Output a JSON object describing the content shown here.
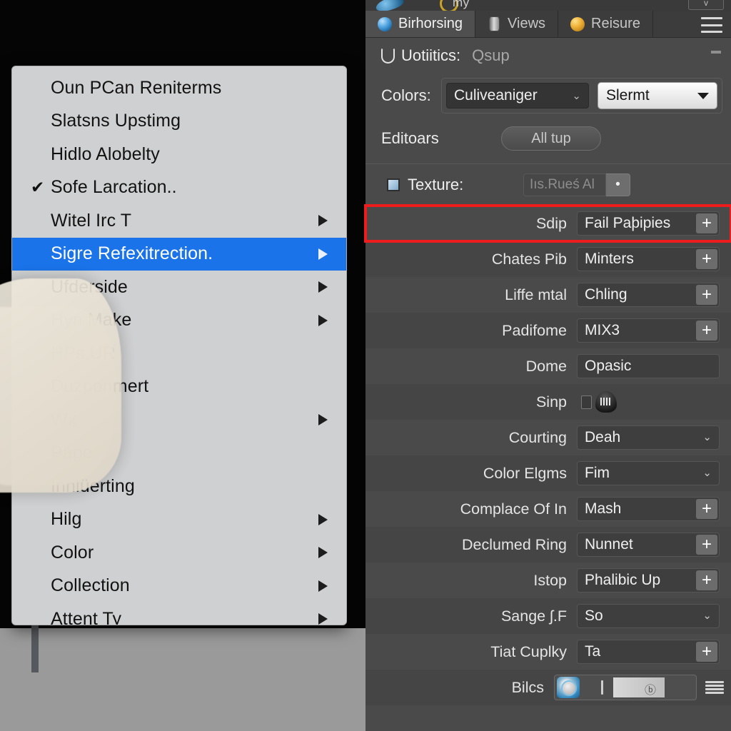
{
  "canvas": {
    "name": "viewport-left"
  },
  "context_menu": {
    "items": [
      {
        "label": "Oun PCan Reniterms",
        "checked": false,
        "submenu": false
      },
      {
        "label": "Slatsns Upstimg",
        "checked": false,
        "submenu": false
      },
      {
        "label": "Hidlo Alobelty",
        "checked": false,
        "submenu": false
      },
      {
        "label": "Sofe Larcation..",
        "checked": true,
        "submenu": false
      },
      {
        "label": "Witel Irc T",
        "checked": false,
        "submenu": true
      },
      {
        "label": "Sigre Refexitrection.",
        "checked": false,
        "submenu": true,
        "selected": true
      },
      {
        "label": "Ufderside",
        "checked": false,
        "submenu": true
      },
      {
        "label": "Hyn Make",
        "checked": false,
        "submenu": true
      },
      {
        "label": "HPs UR",
        "checked": false,
        "submenu": false
      },
      {
        "label": "Duzponmert",
        "checked": false,
        "submenu": false
      },
      {
        "label": "Wx",
        "checked": false,
        "submenu": true
      },
      {
        "label": "Pape",
        "checked": false,
        "submenu": false
      },
      {
        "label": "Inniüerting",
        "checked": false,
        "submenu": false
      },
      {
        "label": "Hilg",
        "checked": false,
        "submenu": true
      },
      {
        "label": "Color",
        "checked": false,
        "submenu": true
      },
      {
        "label": "Collection",
        "checked": false,
        "submenu": true
      },
      {
        "label": "Attent Ty",
        "checked": false,
        "submenu": true
      }
    ],
    "checkmark": "✔",
    "highlight_color": "#1a73e8"
  },
  "panel": {
    "topbar": {
      "title": "my",
      "corner_button": "v"
    },
    "tabs": [
      {
        "label": "Birhorsing",
        "icon": "blue-sphere-icon",
        "active": true
      },
      {
        "label": "Views",
        "icon": "cylinder-icon",
        "active": false
      },
      {
        "label": "Reisure",
        "icon": "orange-sphere-icon",
        "active": false
      }
    ],
    "menu_icon": "hamburger-icon",
    "header": {
      "label": "Uotiitics:",
      "value": "Qsup",
      "minimize": "minimize-icon"
    },
    "colors_row": {
      "label": "Colors:",
      "select_dark": {
        "value": "Culiveaniger",
        "chevron": "⌄"
      },
      "select_light": {
        "value": "Slermt"
      }
    },
    "editors_row": {
      "label": "Editoars",
      "button": "All tup"
    },
    "texture_row": {
      "label": "Texture:",
      "value": "Iıs.Rueś Al",
      "button": "•"
    },
    "properties": [
      {
        "label": "Sdip",
        "value": "Fail Paþipies",
        "control": "plus",
        "highlighted": true
      },
      {
        "label": "Chates Pib",
        "value": "Minters",
        "control": "plus"
      },
      {
        "label": "Liffe mtal",
        "value": "Chling",
        "control": "plus"
      },
      {
        "label": "Padifome",
        "value": "MIX3",
        "control": "plus"
      },
      {
        "label": "Dome",
        "value": "Opasic",
        "control": "none"
      },
      {
        "label": "Sinp",
        "value": "",
        "control": "icons"
      },
      {
        "label": "Courting",
        "value": "Deah",
        "control": "chevron"
      },
      {
        "label": "Color Elgms",
        "value": "Fim",
        "control": "chevron"
      },
      {
        "label": "Complace Of In",
        "value": "Mash",
        "control": "plus"
      },
      {
        "label": "Declumed Ring",
        "value": "Nunnet",
        "control": "plus"
      },
      {
        "label": "Istop",
        "value": "Phalibic Up",
        "control": "plus"
      },
      {
        "label": "Sange ʃ.F",
        "value": "So",
        "control": "chevron"
      },
      {
        "label": "Tiat Cuplky",
        "value": "Ta",
        "control": "plus"
      },
      {
        "label": "Bilcs",
        "value": "",
        "control": "composite"
      }
    ],
    "plus_glyph": "+",
    "chevron_glyph": "⌄",
    "accent_highlight": "#ee1c1c",
    "background": "#4a4a4a"
  }
}
